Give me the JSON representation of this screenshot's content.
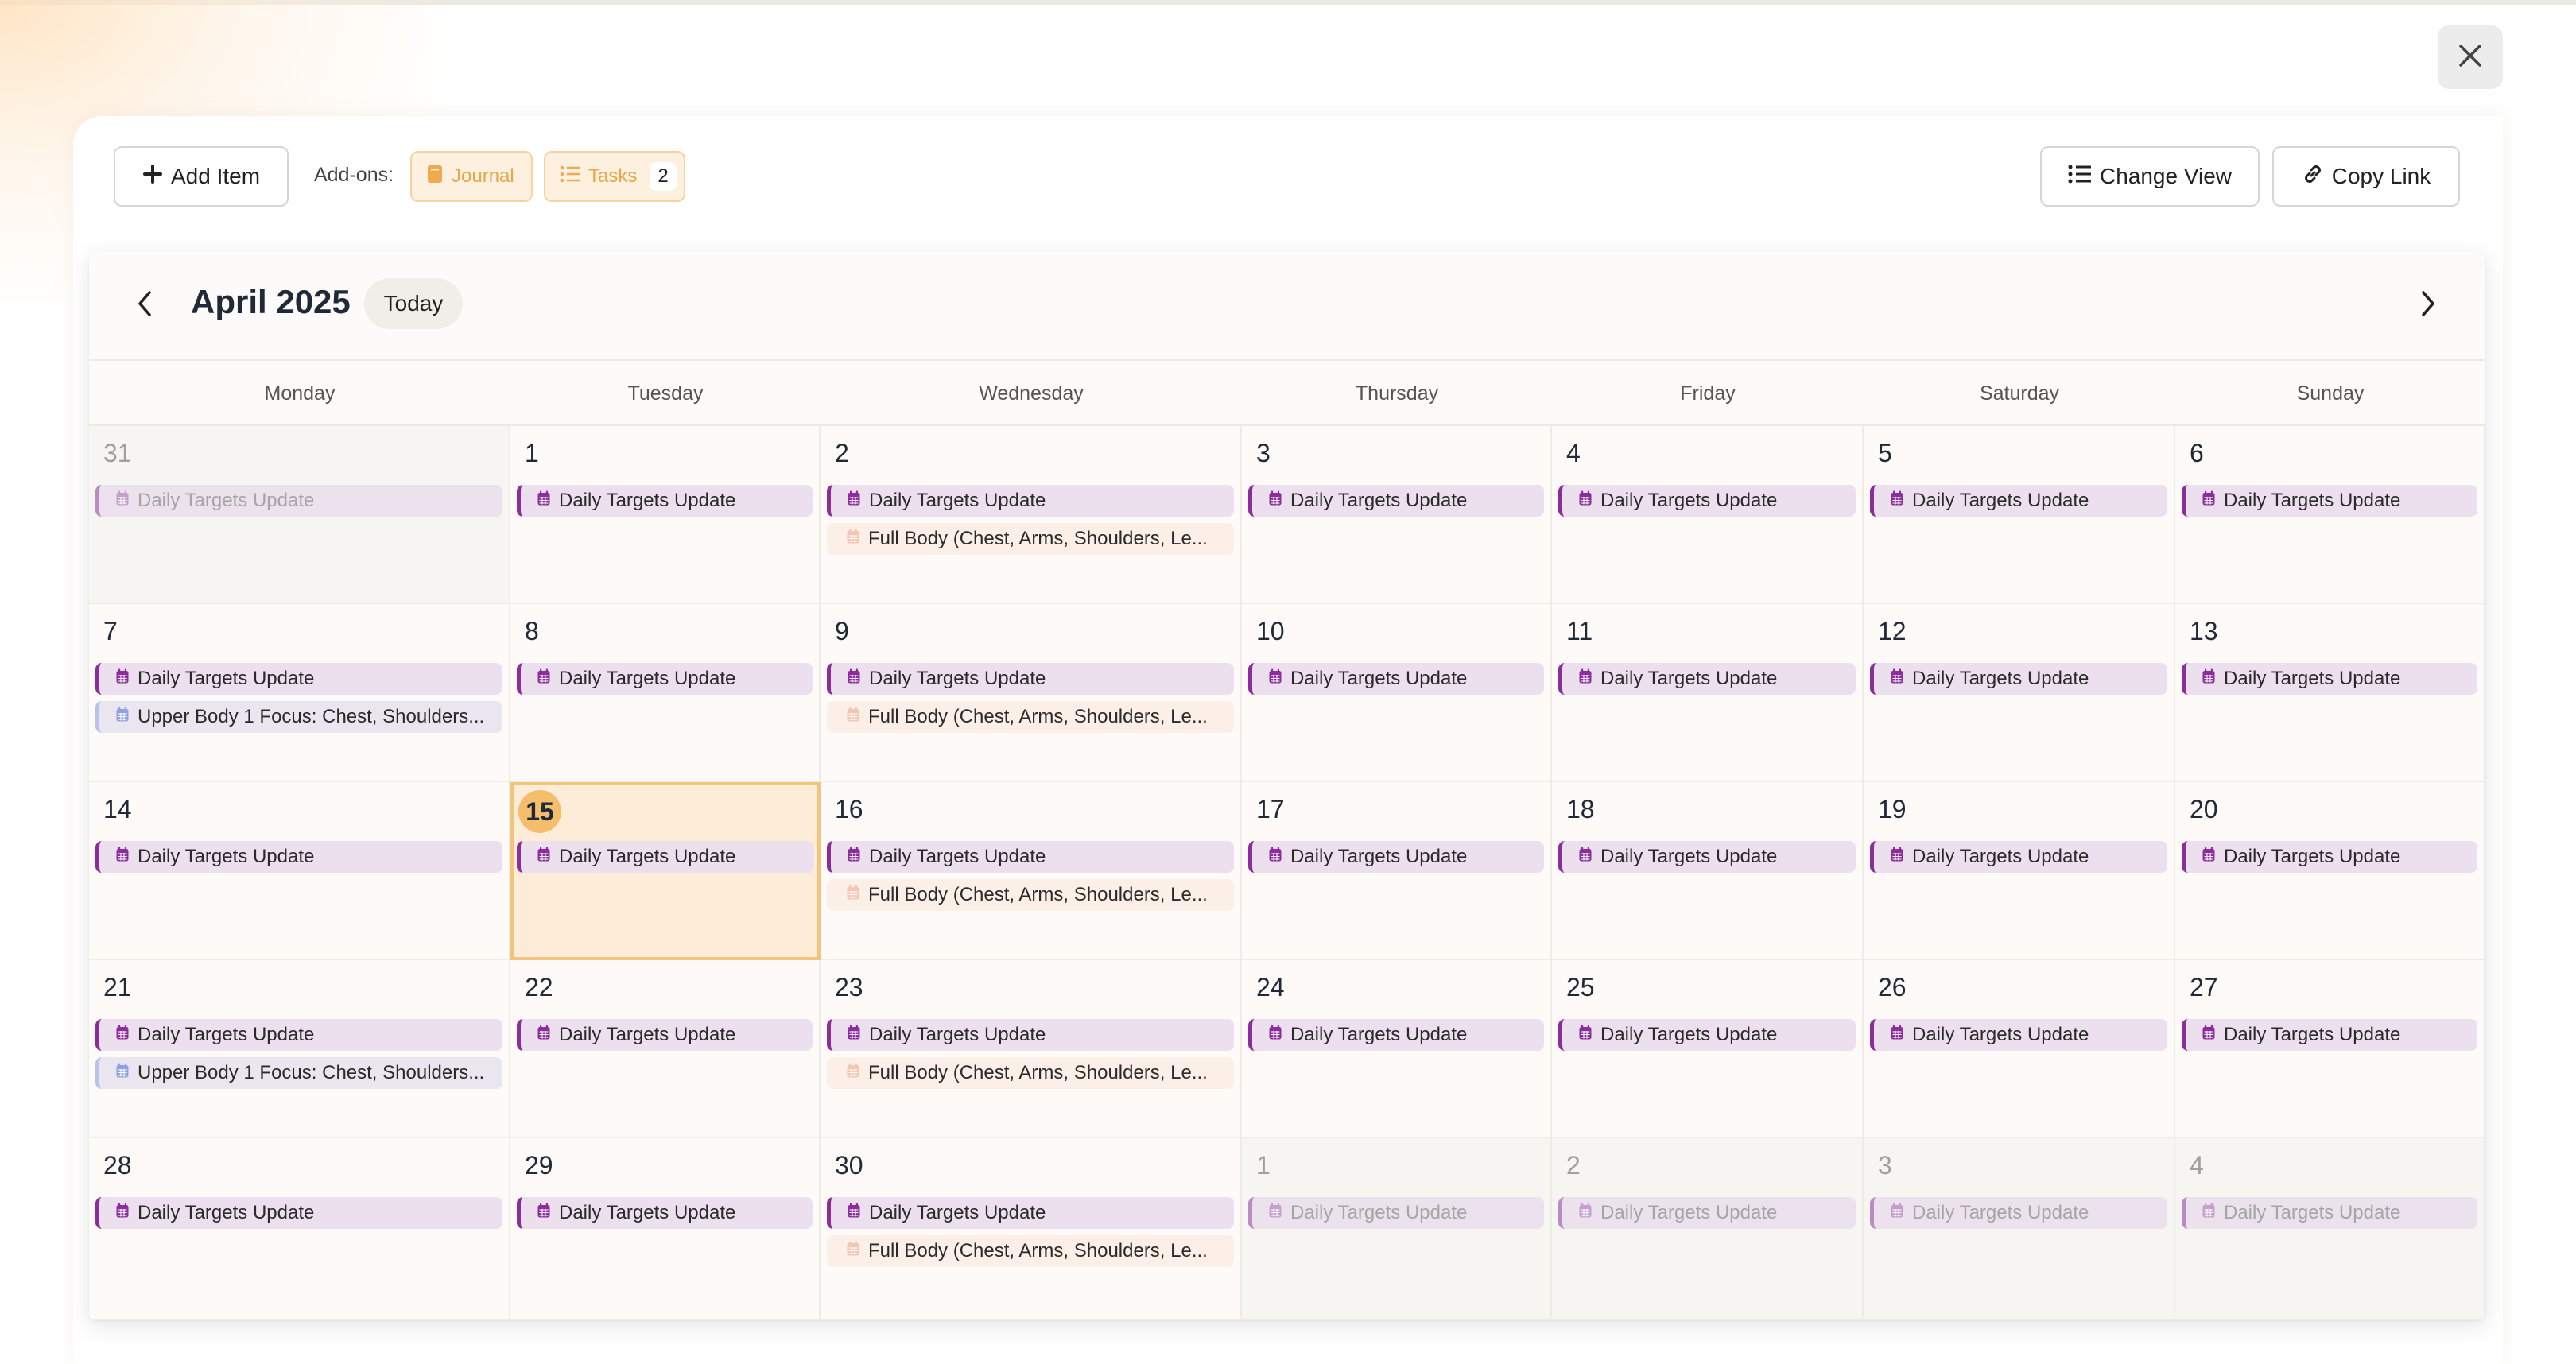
{
  "toolbar": {
    "add_item_label": "Add Item",
    "addons_label": "Add-ons:",
    "journal_label": "Journal",
    "tasks_label": "Tasks",
    "tasks_count": "2",
    "change_view_label": "Change View",
    "copy_link_label": "Copy Link"
  },
  "calendar": {
    "month_title": "April 2025",
    "today_label": "Today",
    "weekdays": [
      "Monday",
      "Tuesday",
      "Wednesday",
      "Thursday",
      "Friday",
      "Saturday",
      "Sunday"
    ],
    "today_date": "15",
    "event_types": {
      "daily": "Daily Targets Update",
      "fullbody": "Full Body (Chest, Arms, Shoulders, Le...",
      "upper": "Upper Body 1 Focus: Chest, Shoulders..."
    },
    "weeks": [
      [
        {
          "day": "31",
          "muted": true,
          "events": [
            "daily"
          ]
        },
        {
          "day": "1",
          "events": [
            "daily"
          ]
        },
        {
          "day": "2",
          "events": [
            "daily",
            "fullbody"
          ]
        },
        {
          "day": "3",
          "events": [
            "daily"
          ]
        },
        {
          "day": "4",
          "events": [
            "daily"
          ]
        },
        {
          "day": "5",
          "events": [
            "daily"
          ]
        },
        {
          "day": "6",
          "events": [
            "daily"
          ]
        }
      ],
      [
        {
          "day": "7",
          "events": [
            "daily",
            "upper"
          ]
        },
        {
          "day": "8",
          "events": [
            "daily"
          ]
        },
        {
          "day": "9",
          "events": [
            "daily",
            "fullbody"
          ]
        },
        {
          "day": "10",
          "events": [
            "daily"
          ]
        },
        {
          "day": "11",
          "events": [
            "daily"
          ]
        },
        {
          "day": "12",
          "events": [
            "daily"
          ]
        },
        {
          "day": "13",
          "events": [
            "daily"
          ]
        }
      ],
      [
        {
          "day": "14",
          "events": [
            "daily"
          ]
        },
        {
          "day": "15",
          "today": true,
          "events": [
            "daily"
          ]
        },
        {
          "day": "16",
          "events": [
            "daily",
            "fullbody"
          ]
        },
        {
          "day": "17",
          "events": [
            "daily"
          ]
        },
        {
          "day": "18",
          "events": [
            "daily"
          ]
        },
        {
          "day": "19",
          "events": [
            "daily"
          ]
        },
        {
          "day": "20",
          "events": [
            "daily"
          ]
        }
      ],
      [
        {
          "day": "21",
          "events": [
            "daily",
            "upper"
          ]
        },
        {
          "day": "22",
          "events": [
            "daily"
          ]
        },
        {
          "day": "23",
          "events": [
            "daily",
            "fullbody"
          ]
        },
        {
          "day": "24",
          "events": [
            "daily"
          ]
        },
        {
          "day": "25",
          "events": [
            "daily"
          ]
        },
        {
          "day": "26",
          "events": [
            "daily"
          ]
        },
        {
          "day": "27",
          "events": [
            "daily"
          ]
        }
      ],
      [
        {
          "day": "28",
          "events": [
            "daily"
          ]
        },
        {
          "day": "29",
          "events": [
            "daily"
          ]
        },
        {
          "day": "30",
          "events": [
            "daily",
            "fullbody"
          ]
        },
        {
          "day": "1",
          "muted": true,
          "events": [
            "daily"
          ]
        },
        {
          "day": "2",
          "muted": true,
          "events": [
            "daily"
          ]
        },
        {
          "day": "3",
          "muted": true,
          "events": [
            "daily"
          ]
        },
        {
          "day": "4",
          "muted": true,
          "events": [
            "daily"
          ]
        }
      ]
    ]
  },
  "icons": {
    "close": "close-icon",
    "add": "plus-icon",
    "journal": "book-icon",
    "tasks": "list-icon",
    "change_view": "list-icon",
    "copy_link": "link-icon",
    "prev": "chevron-left-icon",
    "next": "chevron-right-icon",
    "event": "calendar-icon"
  },
  "colors": {
    "accent_orange": "#f5be6c",
    "event_purple": "#8b2d9a",
    "event_daily_bg": "#ede0ee",
    "event_fullbody_bg": "#fbefe8",
    "event_upper_accent": "#b8c3ea",
    "today_bg": "#fdedd8"
  }
}
